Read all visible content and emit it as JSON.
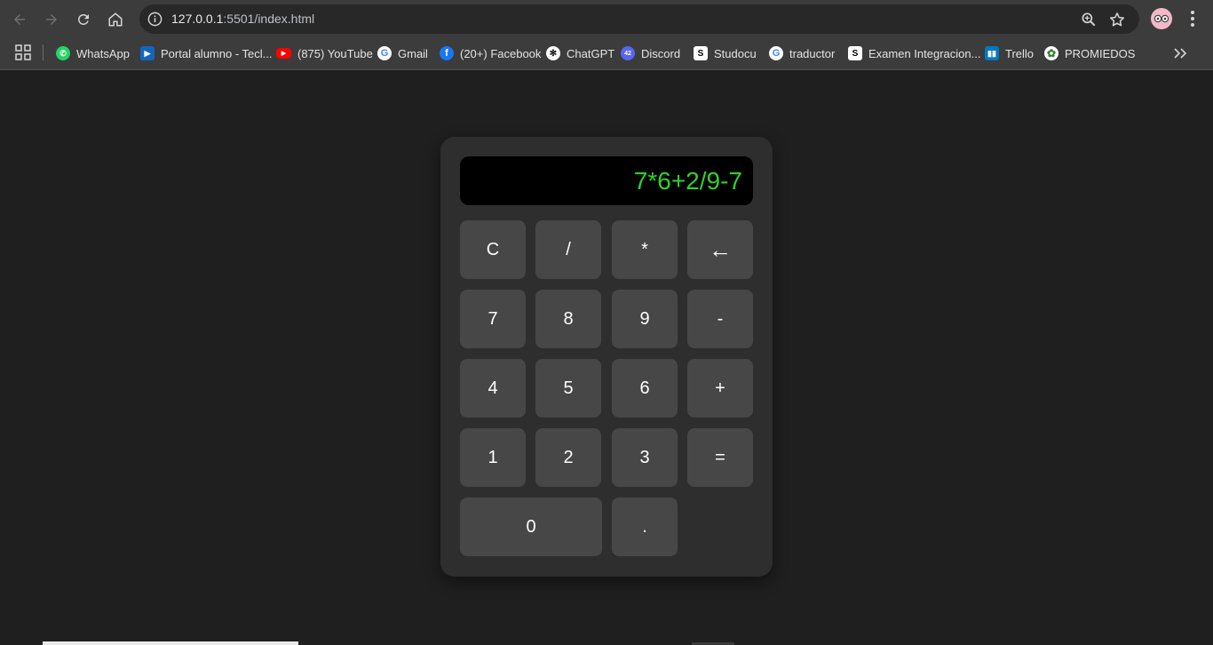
{
  "browser": {
    "url_host": "127.0.0.1",
    "url_path": ":5501/index.html",
    "bookmarks": [
      {
        "label": "WhatsApp",
        "icon": "whatsapp-icon",
        "color": "#25d366"
      },
      {
        "label": "Portal alumno - Tecl...",
        "icon": "portal-icon",
        "color": "#1565c0"
      },
      {
        "label": "(875) YouTube",
        "icon": "youtube-icon",
        "color": "#ff0000"
      },
      {
        "label": "Gmail",
        "icon": "google-icon",
        "color": "#ffffff"
      },
      {
        "label": "(20+) Facebook",
        "icon": "facebook-icon",
        "color": "#1877f2"
      },
      {
        "label": "ChatGPT",
        "icon": "chatgpt-icon",
        "color": "#ffffff"
      },
      {
        "label": "Discord",
        "icon": "discord-icon",
        "color": "#5865f2",
        "badge": "42"
      },
      {
        "label": "Studocu",
        "icon": "studocu-icon",
        "color": "#ffffff"
      },
      {
        "label": "traductor",
        "icon": "google-icon",
        "color": "#ffffff"
      },
      {
        "label": "Examen Integracion...",
        "icon": "studocu-icon",
        "color": "#ffffff"
      },
      {
        "label": "Trello",
        "icon": "trello-icon",
        "color": "#0079bf"
      },
      {
        "label": "PROMIEDOS",
        "icon": "promiedos-icon",
        "color": "#2e7d32"
      }
    ]
  },
  "calculator": {
    "display": "7*6+2/9-7",
    "display_color": "#2ed12e",
    "keys": {
      "clear": "C",
      "divide": "/",
      "multiply": "*",
      "backspace": "←",
      "seven": "7",
      "eight": "8",
      "nine": "9",
      "minus": "-",
      "four": "4",
      "five": "5",
      "six": "6",
      "plus": "+",
      "one": "1",
      "two": "2",
      "three": "3",
      "equals": "=",
      "zero": "0",
      "decimal": "."
    }
  }
}
